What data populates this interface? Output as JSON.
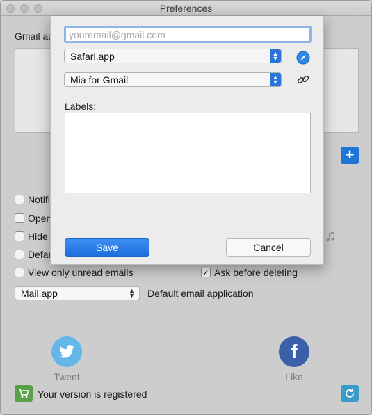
{
  "window": {
    "title": "Preferences"
  },
  "accounts": {
    "label": "Gmail ac"
  },
  "options": {
    "notifications": "Notifi",
    "open": "Open",
    "hide": "Hide s",
    "default": "Defau",
    "view_unread": "View only unread emails",
    "ask_delete": "Ask before deleting"
  },
  "mail_app": {
    "value": "Mail.app",
    "label": "Default email application"
  },
  "social": {
    "tweet": "Tweet",
    "like": "Like"
  },
  "registration": {
    "text": "Your version is registered"
  },
  "dialog": {
    "email_placeholder": "youremail@gmail.com",
    "browser_select": "Safari.app",
    "client_select": "Mia for Gmail",
    "labels_label": "Labels:",
    "save_label": "Save",
    "cancel_label": "Cancel"
  },
  "colors": {
    "accent": "#1e75d8",
    "twitter": "#64b5e8",
    "facebook": "#3b5fa8",
    "register": "#5aa04a"
  }
}
